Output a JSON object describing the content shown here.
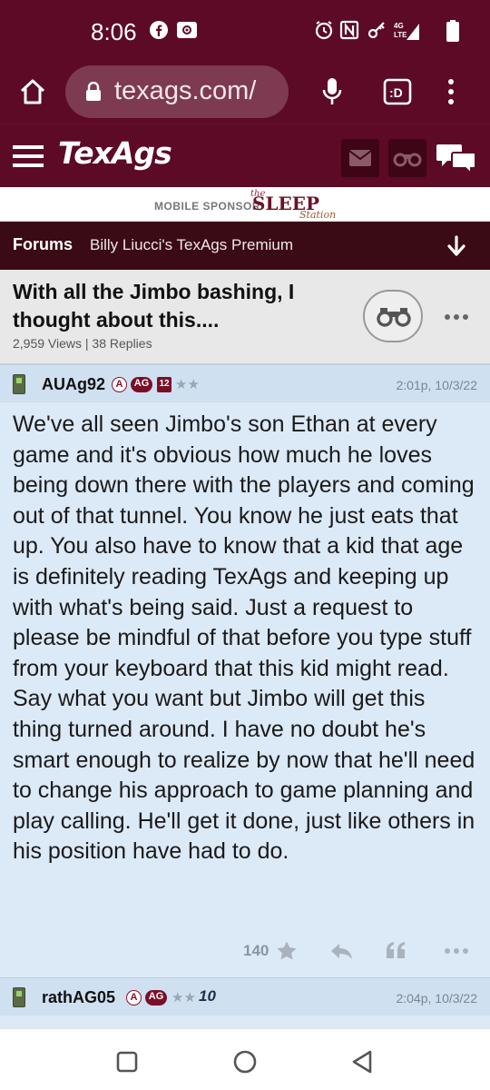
{
  "status_bar": {
    "time": "8:06",
    "network": "4G LTE"
  },
  "browser": {
    "url": "texags.com/"
  },
  "site": {
    "logo": "TexAgs"
  },
  "sponsor": {
    "label": "MOBILE SPONSOR",
    "brand_small": "the",
    "brand": "SLEEP",
    "brand_sub": "Station"
  },
  "breadcrumb": {
    "forums": "Forums",
    "board": "Billy Liucci's TexAgs Premium"
  },
  "topic": {
    "title": "With all the Jimbo bashing, I thought about this....",
    "meta": "2,959 Views | 38 Replies"
  },
  "posts": [
    {
      "username": "AUAg92",
      "badge_a": "A",
      "badge_ag": "AG",
      "badge_12": "12",
      "stars": "★★",
      "timestamp": "2:01p, 10/3/22",
      "body": "We've all seen Jimbo's son Ethan at every game and it's obvious how much he loves being down there with the players and coming out of that tunnel. You know he just eats that up. You also have to know that a kid that age is definitely reading TexAgs and keeping up with what's being said. Just a request to please be mindful of that before you type stuff from your keyboard that this kid might read. Say what you want but Jimbo will get this thing turned around. I have no doubt he's smart enough to realize by now that he'll need to change his approach to game planning and play calling. He'll get it done, just like others in his position have had to do.",
      "likes": "140"
    },
    {
      "username": "rathAG05",
      "badge_a": "A",
      "badge_ag": "AG",
      "stars": "★★",
      "extra_badge": "10",
      "timestamp": "2:04p, 10/3/22"
    }
  ],
  "colors": {
    "maroon": "#5c0a25",
    "dark_maroon": "#3a0a15",
    "post_bg": "#dce9f7",
    "post_header_bg": "#cfe0f0"
  }
}
